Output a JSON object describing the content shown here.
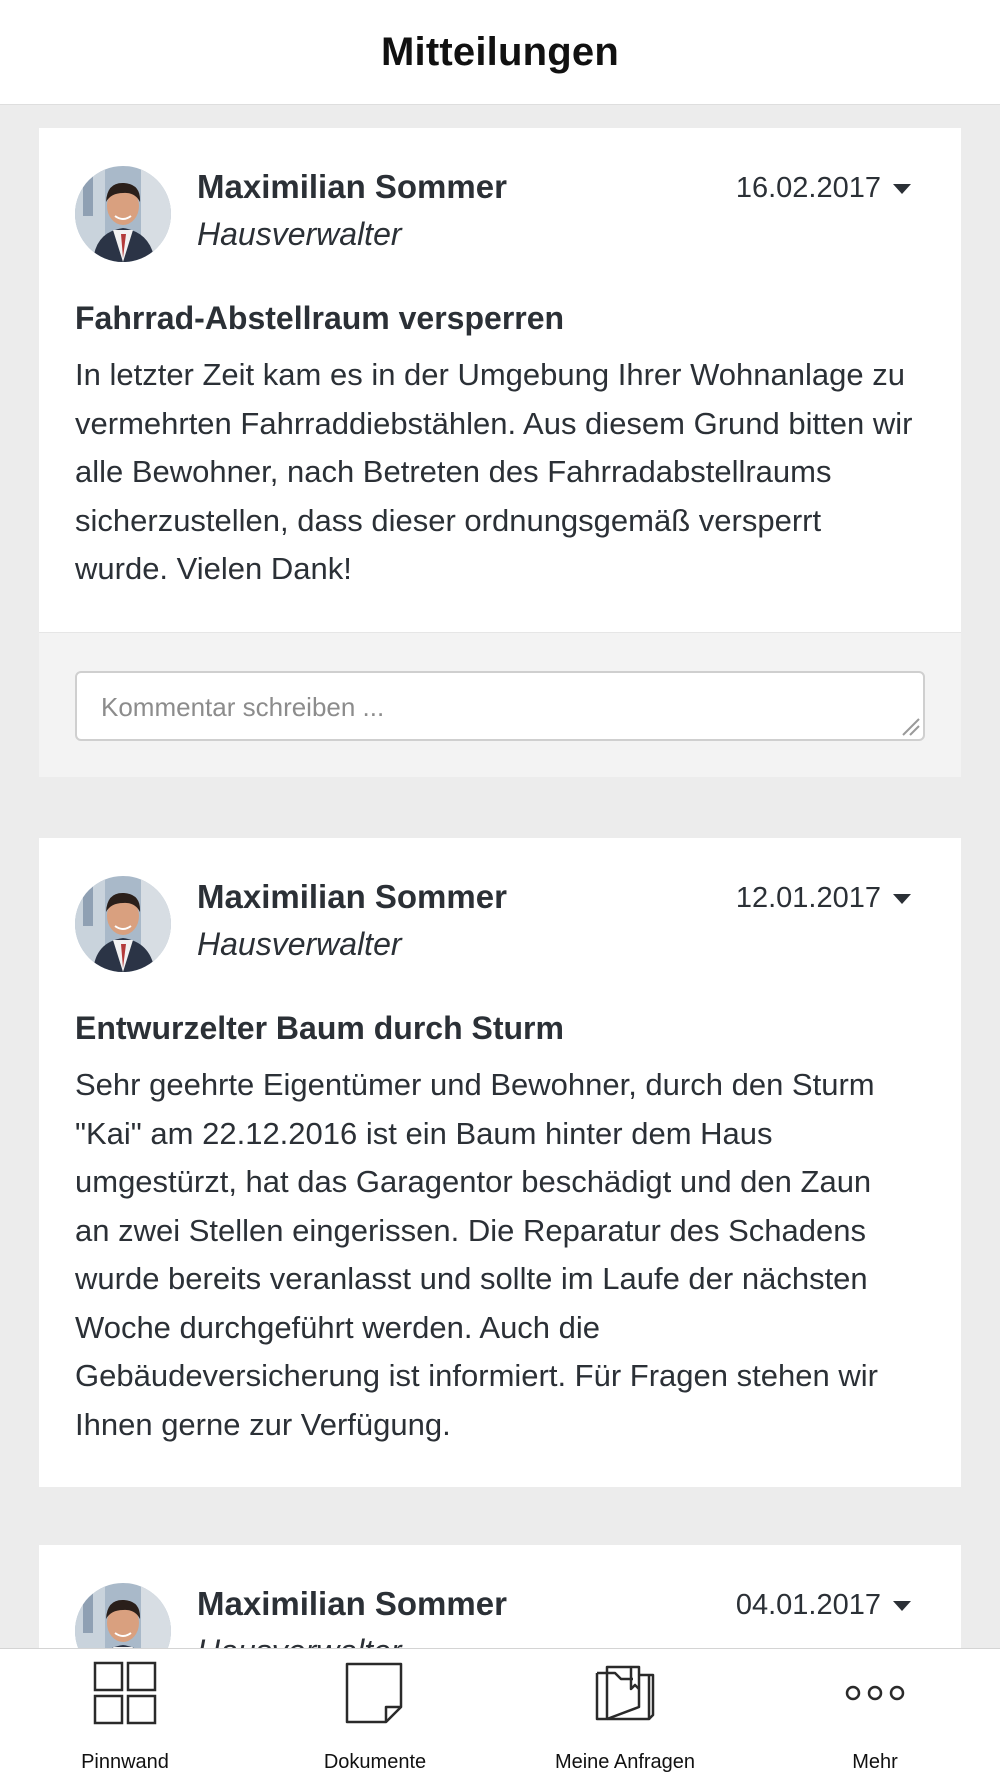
{
  "header": {
    "title": "Mitteilungen"
  },
  "posts": [
    {
      "author": "Maximilian Sommer",
      "role": "Hausverwalter",
      "date": "16.02.2017",
      "title": "Fahrrad-Abstellraum versperren",
      "body": "In letzter Zeit kam es in der Umgebung Ihrer Wohnanlage zu vermehrten Fahrraddiebstählen. Aus diesem Grund bitten wir alle Bewohner, nach Betreten des Fahrradabstellraums sicherzustellen, dass dieser ordnungsgemäß versperrt wurde. Vielen Dank!",
      "comment_placeholder": "Kommentar schreiben ..."
    },
    {
      "author": "Maximilian Sommer",
      "role": "Hausverwalter",
      "date": "12.01.2017",
      "title": "Entwurzelter Baum durch Sturm",
      "body": "Sehr geehrte Eigentümer und Bewohner, durch den Sturm \"Kai\" am 22.12.2016 ist ein Baum hinter dem Haus umgestürzt, hat das Garagentor beschädigt und den Zaun an zwei Stellen eingerissen. Die Reparatur des Schadens wurde bereits veranlasst und sollte im Laufe der nächsten Woche durchgeführt werden. Auch die Gebäudeversicherung ist informiert. Für Fragen stehen wir Ihnen gerne zur Verfügung."
    },
    {
      "author": "Maximilian Sommer",
      "role": "Hausverwalter",
      "date": "04.01.2017"
    }
  ],
  "bottom_nav": {
    "items": [
      {
        "label": "Pinnwand",
        "icon": "grid-icon"
      },
      {
        "label": "Dokumente",
        "icon": "document-icon"
      },
      {
        "label": "Meine Anfragen",
        "icon": "folder-icon"
      },
      {
        "label": "Mehr",
        "icon": "more-icon"
      }
    ]
  }
}
